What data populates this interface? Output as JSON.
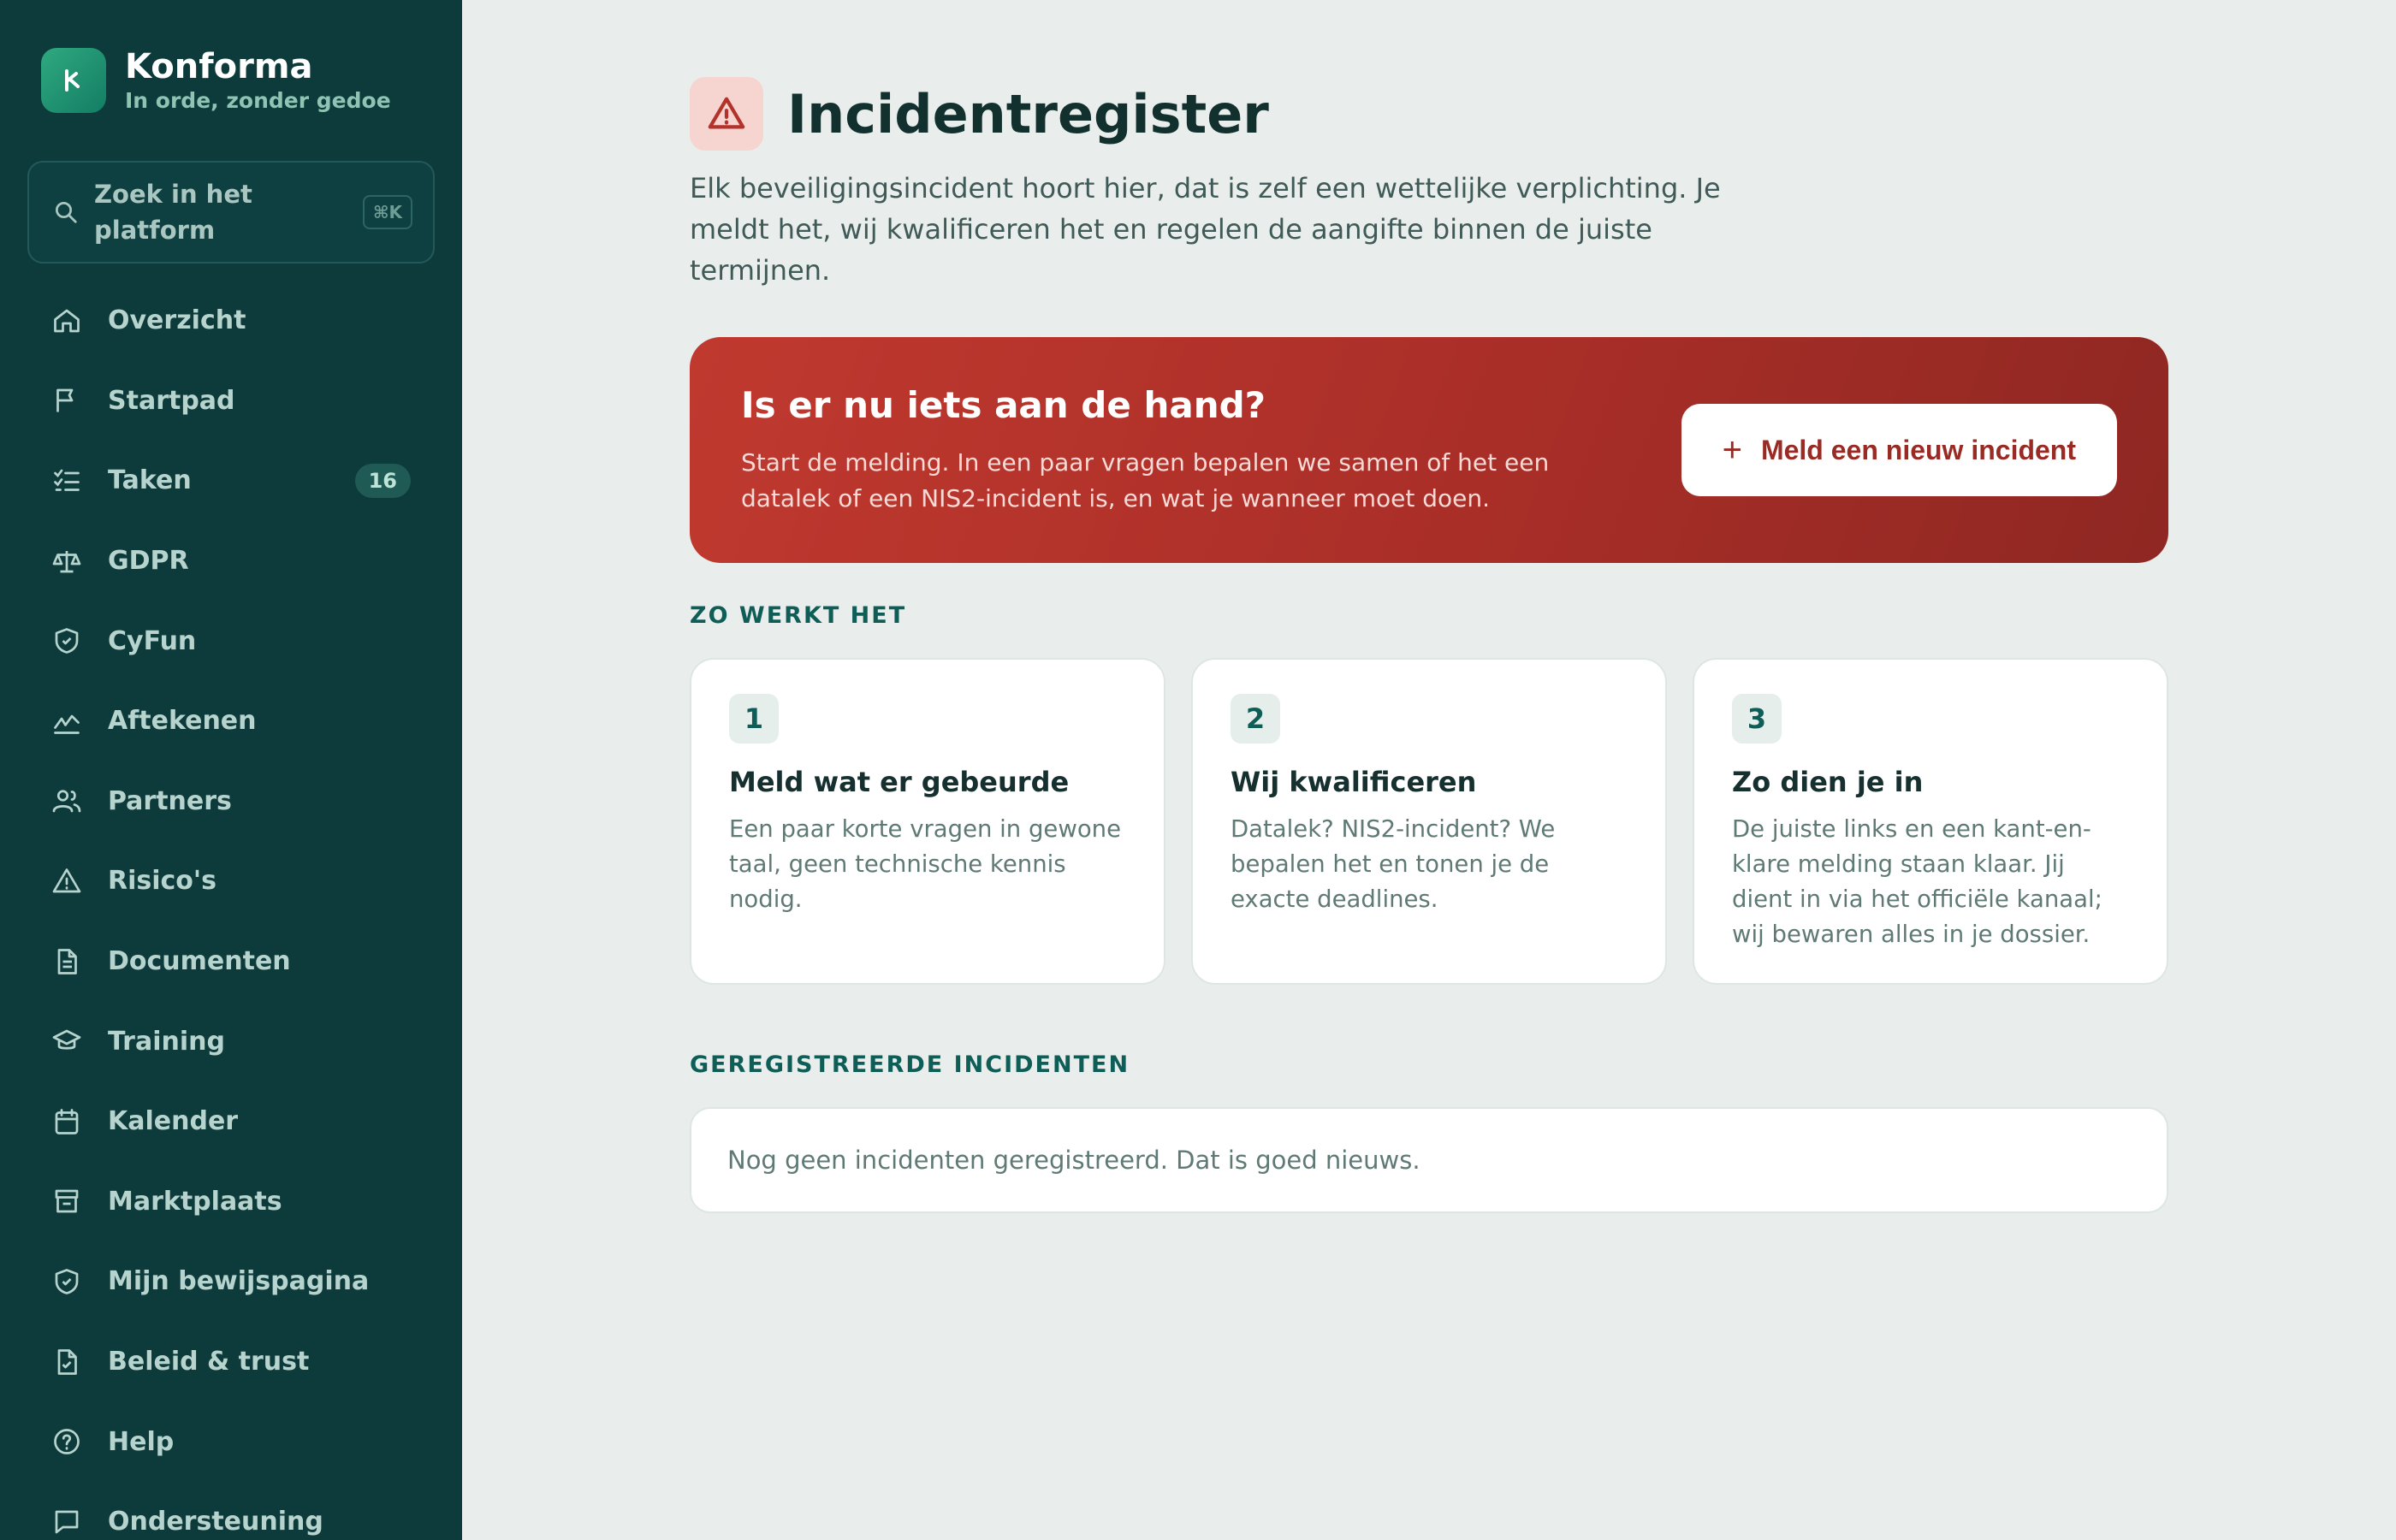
{
  "brand": {
    "name": "Konforma",
    "tagline": "In orde, zonder gedoe"
  },
  "search": {
    "placeholder": "Zoek in het platform",
    "shortcut": "⌘K"
  },
  "nav": [
    {
      "label": "Overzicht",
      "icon": "home-icon"
    },
    {
      "label": "Startpad",
      "icon": "flag-icon"
    },
    {
      "label": "Taken",
      "icon": "checklist-icon",
      "badge": "16"
    },
    {
      "label": "GDPR",
      "icon": "scale-icon"
    },
    {
      "label": "CyFun",
      "icon": "shield-icon"
    },
    {
      "label": "Aftekenen",
      "icon": "signature-icon"
    },
    {
      "label": "Partners",
      "icon": "users-icon"
    },
    {
      "label": "Risico's",
      "icon": "warning-icon"
    },
    {
      "label": "Documenten",
      "icon": "document-icon"
    },
    {
      "label": "Training",
      "icon": "graduation-cap-icon"
    },
    {
      "label": "Kalender",
      "icon": "calendar-icon"
    },
    {
      "label": "Marktplaats",
      "icon": "store-icon"
    },
    {
      "label": "Mijn bewijspagina",
      "icon": "shield-check-icon"
    },
    {
      "label": "Beleid & trust",
      "icon": "file-check-icon"
    },
    {
      "label": "Help",
      "icon": "help-icon"
    },
    {
      "label": "Ondersteuning",
      "icon": "chat-icon"
    }
  ],
  "page": {
    "title": "Incidentregister",
    "description": "Elk beveiligingsincident hoort hier, dat is zelf een wettelijke verplichting. Je meldt het, wij kwalificeren het en regelen de aangifte binnen de juiste termijnen."
  },
  "alert": {
    "title": "Is er nu iets aan de hand?",
    "text": "Start de melding. In een paar vragen bepalen we samen of het een datalek of een NIS2-incident is, en wat je wanneer moet doen.",
    "button": "Meld een nieuw incident"
  },
  "how": {
    "label": "ZO WERKT HET",
    "steps": [
      {
        "num": "1",
        "title": "Meld wat er gebeurde",
        "text": "Een paar korte vragen in gewone taal, geen technische kennis nodig."
      },
      {
        "num": "2",
        "title": "Wij kwalificeren",
        "text": "Datalek? NIS2-incident? We bepalen het en tonen je de exacte deadlines."
      },
      {
        "num": "3",
        "title": "Zo dien je in",
        "text": "De juiste links en een kant-en-klare melding staan klaar. Jij dient in via het officiële kanaal; wij bewaren alles in je dossier."
      }
    ]
  },
  "registered": {
    "label": "GEREGISTREERDE INCIDENTEN",
    "empty": "Nog geen incidenten geregistreerd. Dat is goed nieuws."
  },
  "colors": {
    "sidebar": "#0d3b3c",
    "accent": "#0f5d57",
    "danger": "#b3332b",
    "background": "#e9eeec"
  }
}
